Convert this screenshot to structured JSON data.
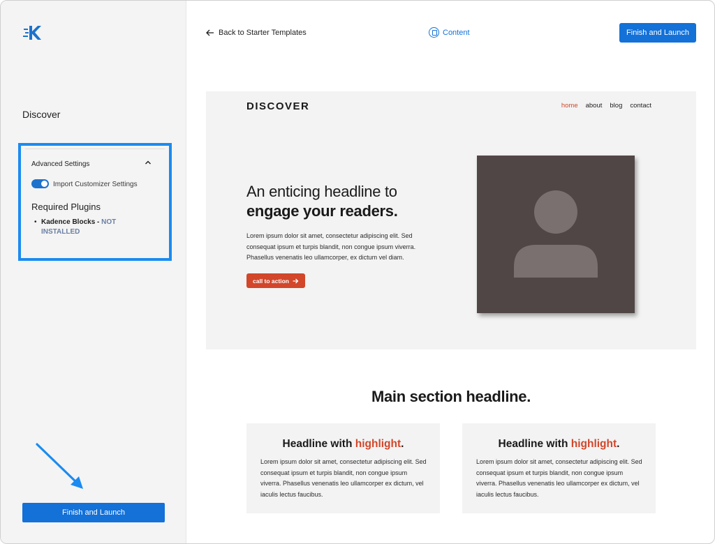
{
  "sidebar": {
    "site_name": "Discover",
    "advanced": {
      "title": "Advanced Settings",
      "toggle_label": "Import Customizer Settings",
      "toggle_on": true,
      "required_title": "Required Plugins",
      "plugins": [
        {
          "name": "Kadence Blocks",
          "separator": " - ",
          "status": "NOT INSTALLED"
        }
      ]
    },
    "finish_label": "Finish and Launch"
  },
  "topbar": {
    "back_label": "Back to Starter Templates",
    "content_label": "Content",
    "finish_label": "Finish and Launch"
  },
  "preview": {
    "logo": "DISCOVER",
    "nav": [
      "home",
      "about",
      "blog",
      "contact"
    ],
    "headline_line1": "An enticing headline to",
    "headline_line2": "engage your readers.",
    "body": "Lorem ipsum dolor sit amet, consectetur adipiscing elit. Sed consequat ipsum et turpis blandit, non congue ipsum viverra. Phasellus venenatis leo ullamcorper, ex dictum vel diam.",
    "cta_label": "call to action",
    "main_headline": "Main section headline.",
    "cards": [
      {
        "title_prefix": "Headline with ",
        "title_highlight": "highlight",
        "title_suffix": ".",
        "body": "Lorem ipsum dolor sit amet, consectetur adipiscing elit. Sed consequat ipsum et turpis blandit, non congue ipsum viverra. Phasellus venenatis leo ullamcorper ex dictum, vel iaculis lectus faucibus."
      },
      {
        "title_prefix": "Headline with ",
        "title_highlight": "highlight",
        "title_suffix": ".",
        "body": "Lorem ipsum dolor sit amet, consectetur adipiscing elit. Sed consequat ipsum et turpis blandit, non congue ipsum viverra. Phasellus venenatis leo ullamcorper ex dictum, vel iaculis lectus faucibus."
      }
    ]
  },
  "colors": {
    "primary": "#1371d8",
    "highlight_box": "#1b8bf0",
    "accent": "#d2462a",
    "image_bg": "#514646"
  },
  "icons": {
    "logo": "kadence-logo-icon",
    "back": "arrow-left-icon",
    "content": "content-icon",
    "collapse": "chevron-up-icon",
    "cta": "arrow-right-icon",
    "placeholder": "person-placeholder-icon",
    "annotation": "annotation-arrow-icon"
  }
}
